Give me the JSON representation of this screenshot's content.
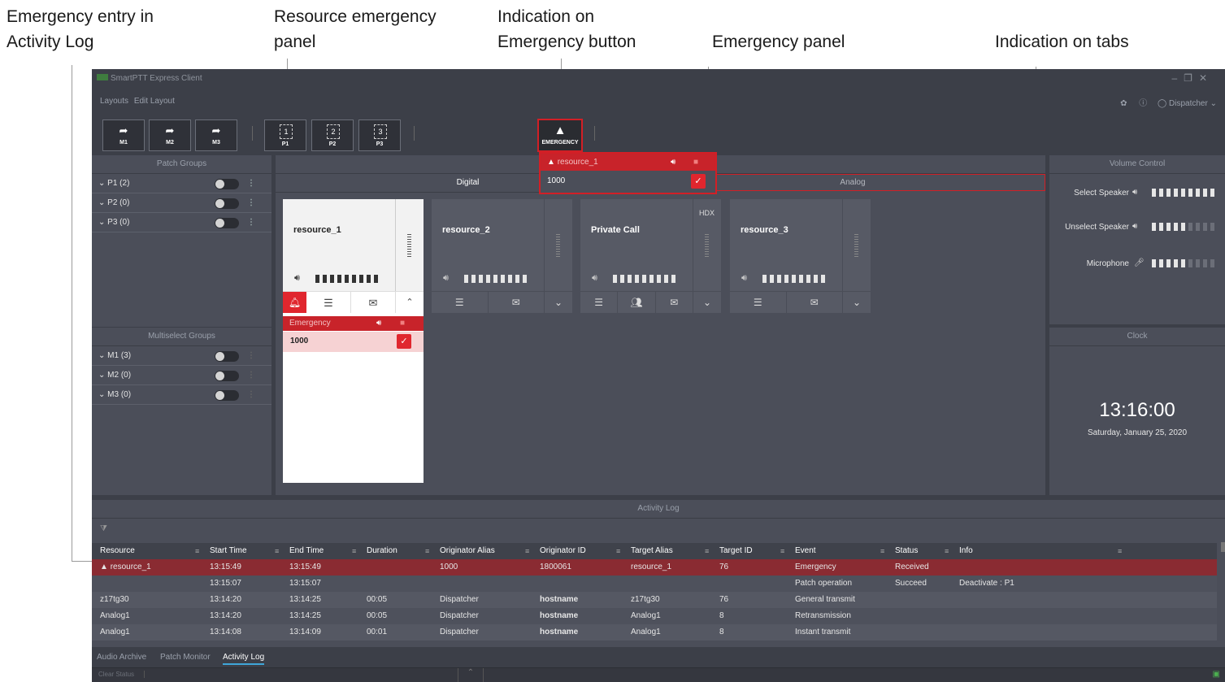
{
  "callouts": {
    "activity_log_entry": "Emergency entry in Activity Log",
    "resource_emergency_panel": "Resource emergency panel",
    "emergency_button_indication": "Indication on Emergency button",
    "emergency_panel": "Emergency panel",
    "tabs_indication": "Indication on tabs"
  },
  "window": {
    "title": "SmartPTT Express Client"
  },
  "menu": {
    "layouts": "Layouts",
    "edit_layout": "Edit Layout",
    "user": "Dispatcher"
  },
  "toolbar": {
    "buttons": [
      {
        "label": "M1",
        "icon": "➦"
      },
      {
        "label": "M2",
        "icon": "➦"
      },
      {
        "label": "M3",
        "icon": "➦"
      },
      {
        "label": "P1",
        "icon": "1"
      },
      {
        "label": "P2",
        "icon": "2"
      },
      {
        "label": "P3",
        "icon": "3"
      }
    ],
    "emergency_label": "EMERGENCY"
  },
  "patch_groups": {
    "header": "Patch Groups",
    "items": [
      {
        "label": "P1 (2)"
      },
      {
        "label": "P2 (0)"
      },
      {
        "label": "P3 (0)"
      }
    ]
  },
  "multiselect_groups": {
    "header": "Multiselect Groups",
    "items": [
      {
        "label": "M1 (3)"
      },
      {
        "label": "M2 (0)"
      },
      {
        "label": "M3 (0)"
      }
    ]
  },
  "emergency_popup": {
    "title": "resource_1",
    "value": "1000"
  },
  "tabs": {
    "digital": "Digital",
    "analog": "Analog"
  },
  "resources": [
    {
      "name": "resource_1",
      "tag": ""
    },
    {
      "name": "resource_2",
      "tag": ""
    },
    {
      "name": "Private Call",
      "tag": "HDX"
    },
    {
      "name": "resource_3",
      "tag": ""
    }
  ],
  "resource_emergency": {
    "title": "Emergency",
    "value": "1000"
  },
  "volume_control": {
    "header": "Volume Control",
    "rows": [
      {
        "label": "Select Speaker",
        "level": 1.0
      },
      {
        "label": "Unselect Speaker",
        "level": 0.6
      },
      {
        "label": "Microphone",
        "level": 0.6
      }
    ]
  },
  "clock": {
    "header": "Clock",
    "time": "13:16:00",
    "date": "Saturday, January 25, 2020"
  },
  "activity_log": {
    "header": "Activity Log",
    "columns": [
      "Resource",
      "Start Time",
      "End Time",
      "Duration",
      "Originator Alias",
      "Originator ID",
      "Target Alias",
      "Target ID",
      "Event",
      "Status",
      "Info"
    ],
    "rows": [
      [
        "resource_1",
        "13:15:49",
        "13:15:49",
        "",
        "1000",
        "1800061",
        "resource_1",
        "76",
        "Emergency",
        "Received",
        ""
      ],
      [
        "",
        "13:15:07",
        "13:15:07",
        "",
        "",
        "",
        "",
        "",
        "Patch operation",
        "Succeed",
        "Deactivate : P1"
      ],
      [
        "z17tg30",
        "13:14:20",
        "13:14:25",
        "00:05",
        "Dispatcher",
        "hostname",
        "z17tg30",
        "76",
        "General transmit",
        "",
        ""
      ],
      [
        "Analog1",
        "13:14:20",
        "13:14:25",
        "00:05",
        "Dispatcher",
        "hostname",
        "Analog1",
        "8",
        "Retransmission",
        "",
        ""
      ],
      [
        "Analog1",
        "13:14:08",
        "13:14:09",
        "00:01",
        "Dispatcher",
        "hostname",
        "Analog1",
        "8",
        "Instant transmit",
        "",
        ""
      ]
    ]
  },
  "bottom_tabs": [
    "Audio Archive",
    "Patch Monitor",
    "Activity Log"
  ],
  "status_bar": {
    "clear_status": "Clear Status"
  }
}
